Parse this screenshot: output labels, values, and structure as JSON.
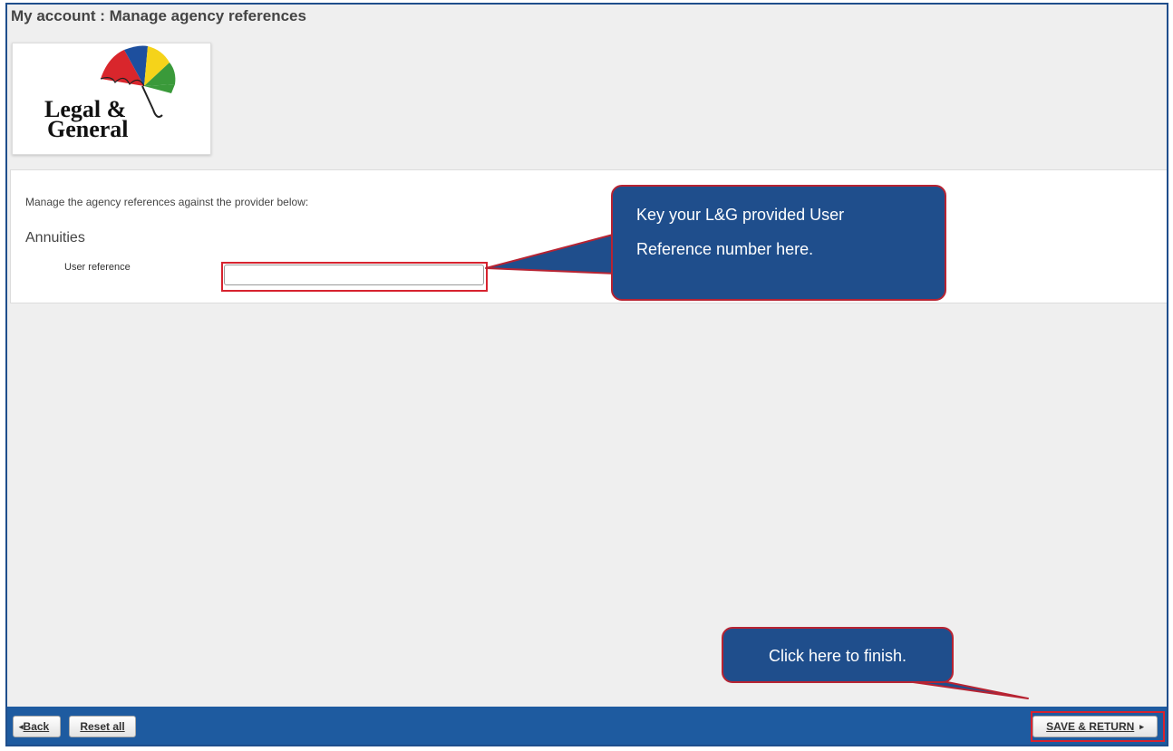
{
  "header": {
    "title": "My account : Manage agency references"
  },
  "logo": {
    "line1": "Legal &",
    "line2": "General"
  },
  "form": {
    "intro": "Manage the agency references against the provider below:",
    "section_title": "Annuities",
    "user_reference_label": "User reference",
    "user_reference_value": ""
  },
  "toolbar": {
    "back_label": "Back",
    "reset_label": "Reset all",
    "save_label": "SAVE & RETURN"
  },
  "callouts": {
    "reference": "Key your L&G provided User Reference number here.",
    "finish": "Click here to finish."
  },
  "colors": {
    "toolbar": "#1e5ba0",
    "callout_fill": "#1f4e8c",
    "highlight": "#d7232f",
    "background": "#efefef"
  }
}
